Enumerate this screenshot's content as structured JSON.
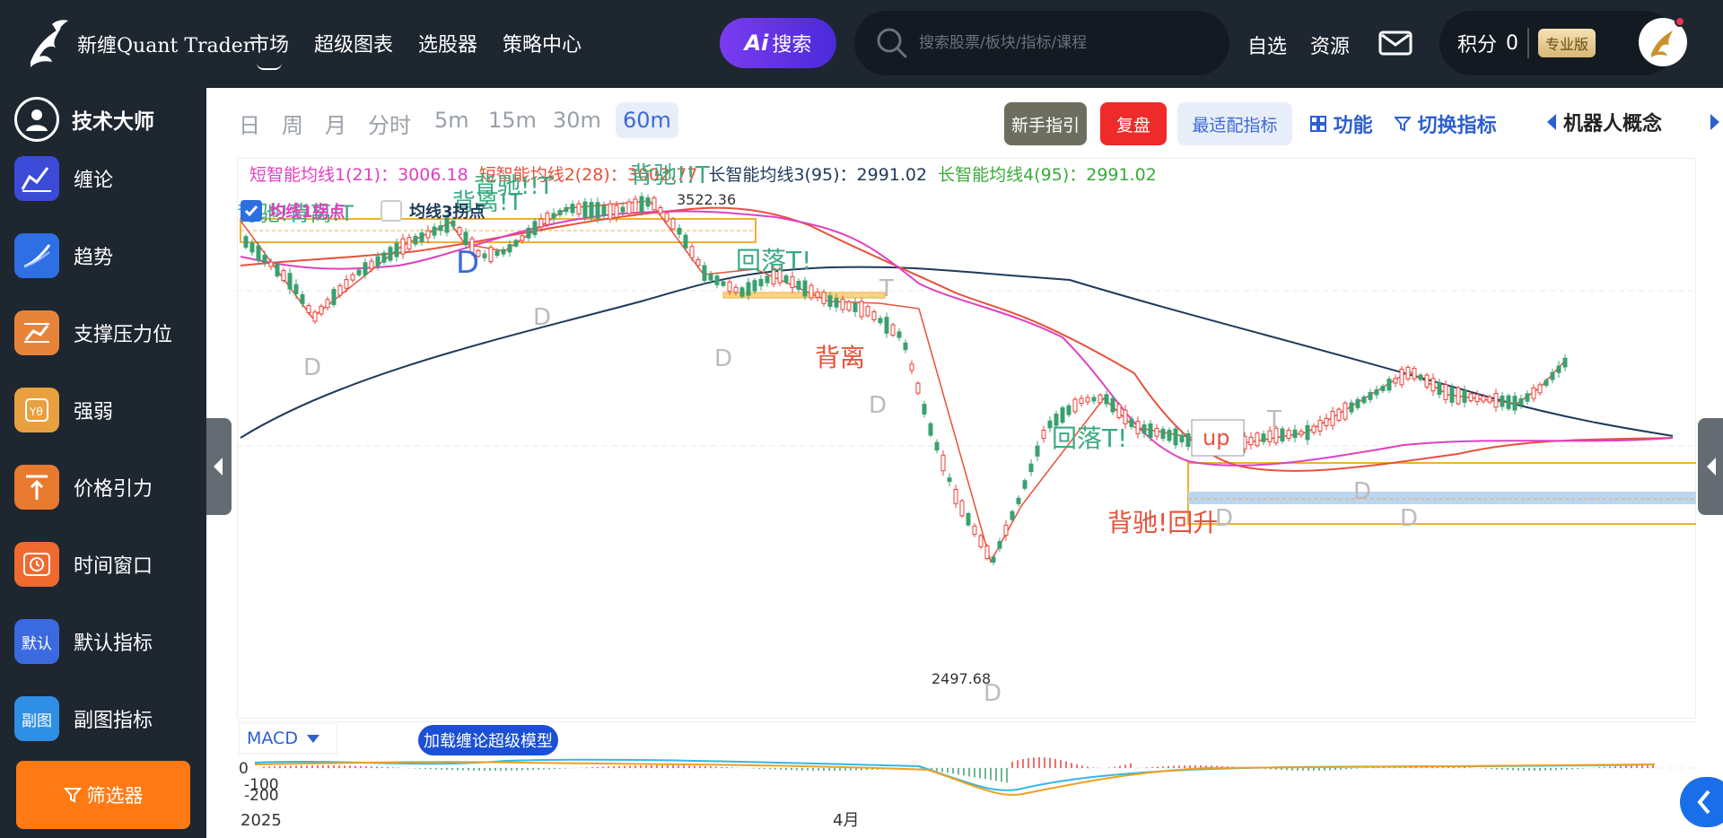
{
  "header": {
    "logo_text": "新缠Quant Trader",
    "nav": [
      {
        "label": "市场",
        "active": true
      },
      {
        "label": "超级图表",
        "active": false
      },
      {
        "label": "选股器",
        "active": false
      },
      {
        "label": "策略中心",
        "active": false
      }
    ],
    "ai_search_label": "搜索",
    "ai_badge": "Ai",
    "search_placeholder": "搜索股票/板块/指标/课程",
    "watchlist": "自选",
    "resources": "资源",
    "points_label": "积分",
    "points_value": "0",
    "pro_badge": "专业版"
  },
  "sidebar": {
    "title": "技术大师",
    "items": [
      {
        "label": "缠论",
        "icon": "chan-chart-icon",
        "color": "#3b4bd8"
      },
      {
        "label": "趋势",
        "icon": "trend-icon",
        "color": "#2f6fe4"
      },
      {
        "label": "支撑压力位",
        "icon": "support-resistance-icon",
        "color": "#e8843a"
      },
      {
        "label": "强弱",
        "icon": "strength-icon",
        "color": "#e8a040"
      },
      {
        "label": "价格引力",
        "icon": "price-gravity-icon",
        "color": "#e87a30"
      },
      {
        "label": "时间窗口",
        "icon": "time-window-icon",
        "color": "#f06a30"
      },
      {
        "label": "默认指标",
        "icon": "default-indicator-icon",
        "color": "#3b6ae0",
        "text": "默认"
      },
      {
        "label": "副图指标",
        "icon": "sub-chart-icon",
        "color": "#2f8fe4",
        "text": "副图"
      }
    ],
    "screener": "筛选器"
  },
  "toolbar": {
    "timeframes": [
      "日",
      "周",
      "月",
      "分时",
      "5m",
      "15m",
      "30m",
      "60m"
    ],
    "active_timeframe": "60m",
    "guide": "新手指引",
    "review": "复盘",
    "best_fit": "最适配指标",
    "functions": "功能",
    "switch_indicator": "切换指标",
    "concept": "机器人概念"
  },
  "legend": {
    "ma1": "短智能均线1(21)：3006.18",
    "ma2": "短智能均线2(28)：3002.77",
    "ma3": "长智能均线3(95)：2991.02",
    "ma4": "长智能均线4(95)：2991.02",
    "colors": {
      "ma1": "#e040c0",
      "ma2": "#e8503a",
      "ma3": "#1e3a5a",
      "ma4": "#3aaa3a"
    }
  },
  "checkboxes": {
    "ma1_pivot": {
      "label": "均线1拐点",
      "checked": true
    },
    "ma3_pivot": {
      "label": "均线3拐点",
      "checked": false
    }
  },
  "chart_data": {
    "type": "candlestick",
    "period": "60m",
    "high_label": "3522.36",
    "low_label": "2497.68",
    "annotations": [
      "背驰!背离!T",
      "背离!T",
      "背驰!!T",
      "背驰!!T",
      "回落T!",
      "背离",
      "回落T!",
      "背驰!回升",
      "up"
    ],
    "pivot_labels": [
      "D",
      "D",
      "D",
      "D",
      "D",
      "T",
      "D",
      "D",
      "D",
      "T",
      "D"
    ],
    "x_ticks": [
      "2025",
      "4月"
    ]
  },
  "subchart": {
    "indicator": "MACD",
    "load_model": "加载缠论超级模型",
    "y_ticks": [
      "0",
      "-100",
      "-200"
    ]
  }
}
